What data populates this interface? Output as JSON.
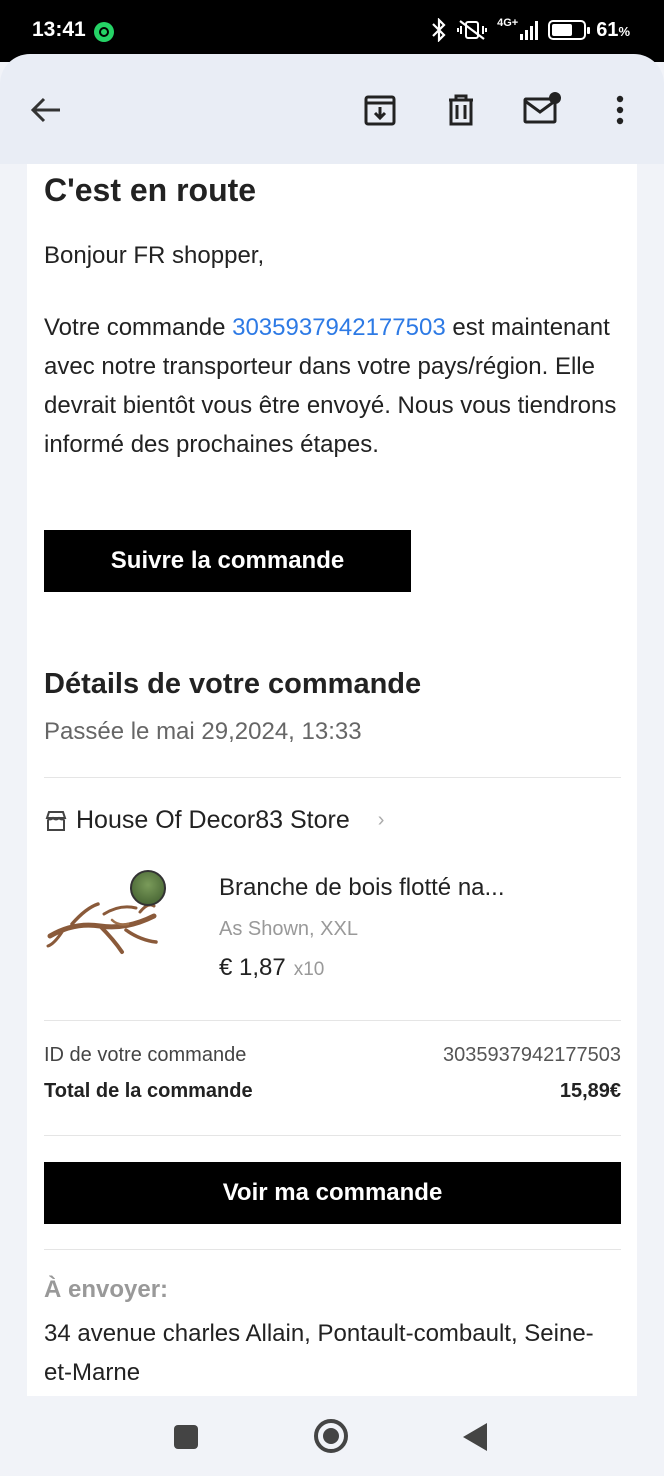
{
  "status_bar": {
    "time": "13:41",
    "network": "4G+",
    "battery": "61",
    "battery_unit": "%"
  },
  "toolbar": {
    "icons": [
      "back-arrow-icon",
      "archive-icon",
      "delete-icon",
      "mark-unread-icon",
      "more-vert-icon"
    ]
  },
  "email": {
    "heading": "C'est en route",
    "greeting": "Bonjour FR shopper,",
    "body_prefix": "Votre commande ",
    "order_number_link": "3035937942177503",
    "body_suffix": " est maintenant avec notre transporteur dans votre pays/région. Elle devrait bientôt vous être envoyé. Nous vous tiendrons informé des prochaines étapes.",
    "track_button": "Suivre la commande",
    "details_title": "Détails de votre commande",
    "placed_on": "Passée le mai 29,2024, 13:33",
    "store": {
      "name": "House Of Decor83 Store",
      "chevron": "›"
    },
    "product": {
      "name": "Branche de bois flotté na...",
      "variant": "As Shown, XXL",
      "price": "€ 1,87",
      "quantity": "x10"
    },
    "summary": {
      "order_id_label": "ID de votre commande",
      "order_id_value": "3035937942177503",
      "total_label": "Total de la commande",
      "total_value": "15,89€"
    },
    "view_button": "Voir ma commande",
    "ship_label": "À envoyer:",
    "ship_address": "34 avenue charles Allain, Pontault-combault, Seine-et-Marne"
  },
  "colors": {
    "link": "#2d7ae5",
    "button_bg": "#000000",
    "button_text": "#ffffff"
  }
}
